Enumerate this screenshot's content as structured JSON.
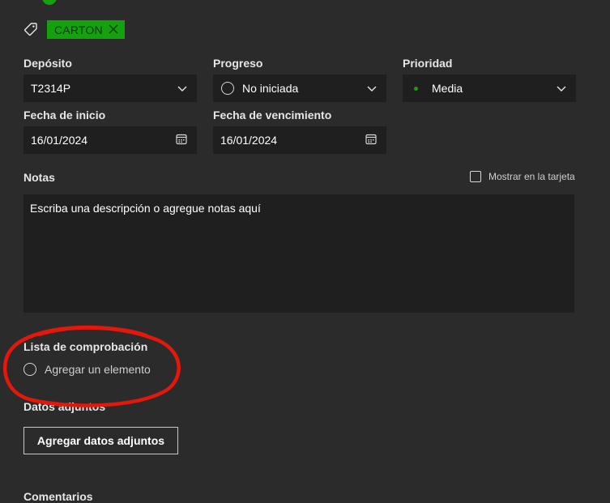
{
  "tags": {
    "label": "CARTON"
  },
  "fields": {
    "bucket": {
      "label": "Depósito",
      "value": "T2314P"
    },
    "progress": {
      "label": "Progreso",
      "value": "No iniciada"
    },
    "priority": {
      "label": "Prioridad",
      "value": "Media"
    },
    "start_date": {
      "label": "Fecha de inicio",
      "value": "16/01/2024"
    },
    "due_date": {
      "label": "Fecha de vencimiento",
      "value": "16/01/2024"
    }
  },
  "notes": {
    "label": "Notas",
    "placeholder": "Escriba una descripción o agregue notas aquí",
    "show_on_card": "Mostrar en la tarjeta"
  },
  "checklist": {
    "label": "Lista de comprobación",
    "add_item": "Agregar un elemento"
  },
  "attachments": {
    "label": "Datos adjuntos",
    "add_button": "Agregar datos adjuntos"
  },
  "comments": {
    "label": "Comentarios"
  },
  "colors": {
    "accent": "#13a10e",
    "panel": "#2b2b2b",
    "field": "#1f1f1f",
    "annotation": "#e3170a"
  }
}
